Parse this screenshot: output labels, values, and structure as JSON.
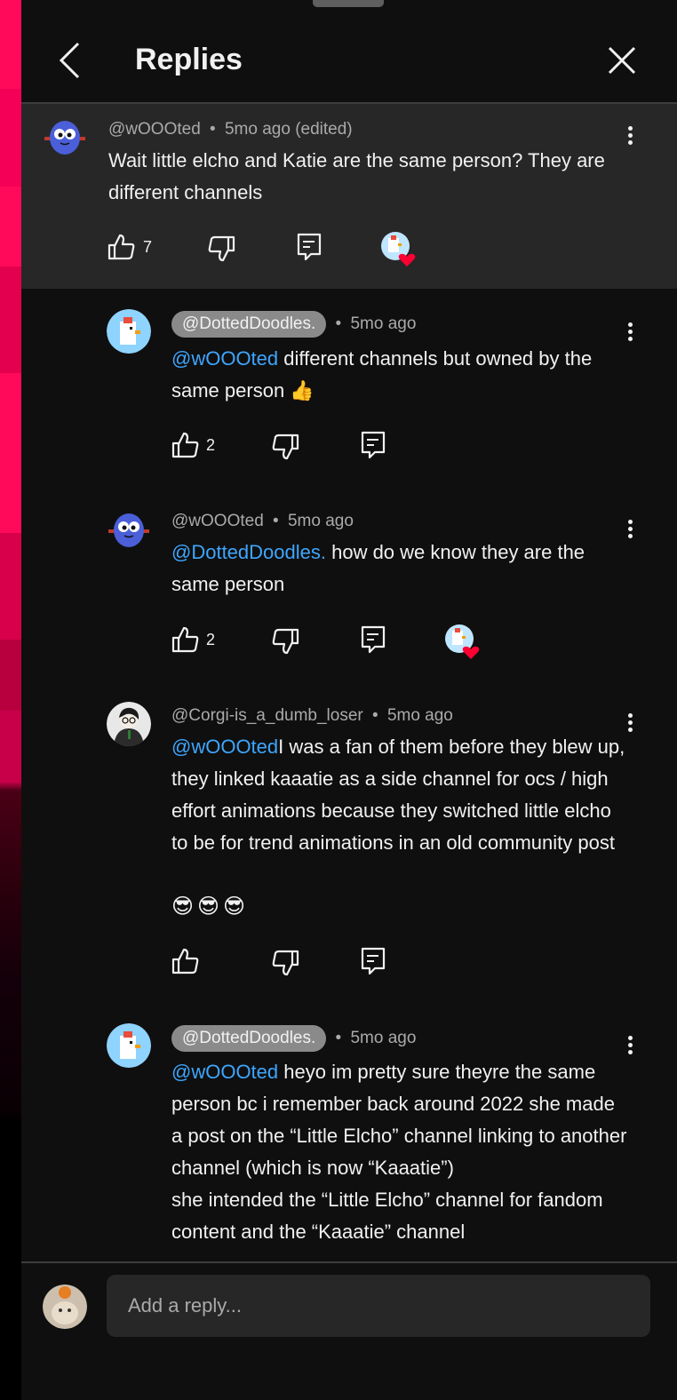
{
  "header": {
    "title": "Replies"
  },
  "parent_comment": {
    "author": "@wOOOted",
    "time": "5mo ago (edited)",
    "text": "Wait little elcho and Katie are the same person? They are different channels",
    "likes": "7"
  },
  "replies": [
    {
      "author": "@DottedDoodles.",
      "time": "5mo ago",
      "mention": "@wOOOted",
      "text": " different channels but owned by the same person 👍",
      "likes": "2"
    },
    {
      "author": "@wOOOted",
      "time": "5mo ago",
      "mention": "@DottedDoodles.",
      "text": " how do we know they are the same person",
      "likes": "2"
    },
    {
      "author": "@Corgi-is_a_dumb_loser",
      "time": "5mo ago",
      "mention": "@wOOOted",
      "text": "I was a fan of them before they blew up, they linked kaaatie as a side channel for ocs / high effort animations because they switched little elcho to be for trend animations in an old community post",
      "emoji": "😎😎😎",
      "likes": ""
    },
    {
      "author": "@DottedDoodles.",
      "time": "5mo ago",
      "mention": "@wOOOted",
      "text": " heyo im pretty sure theyre the same person bc i remember back around 2022 she made a post on the “Little Elcho” channel linking to another channel (which is now “Kaaatie”)",
      "text2": "she intended the “Little Elcho” channel for fandom content and the “Kaaatie” channel",
      "likes": ""
    }
  ],
  "footer": {
    "reply_placeholder": "Add a reply..."
  },
  "separator": "•",
  "icons": {
    "back": "chevron-left-icon",
    "close": "close-icon",
    "like": "thumbs-up-icon",
    "dislike": "thumbs-down-icon",
    "reply": "reply-icon",
    "more": "more-vert-icon"
  },
  "colors": {
    "background": "#0f0f0f",
    "highlight": "#272727",
    "mention": "#3ea6ff",
    "heart": "#ff0033"
  }
}
